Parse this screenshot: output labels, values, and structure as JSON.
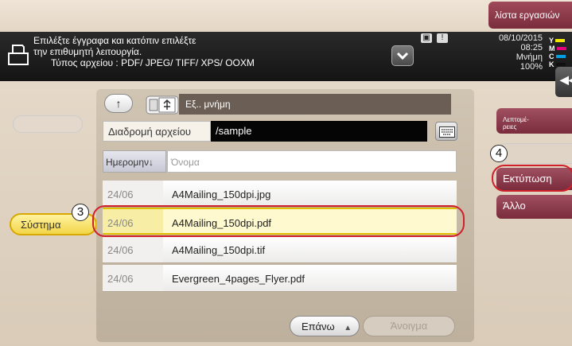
{
  "header": {
    "job_list": "λίστα εργασιών",
    "message_line1": "Επιλέξτε έγγραφα και κατόπιν επιλέξτε",
    "message_line2": "την επιθυμητή λειτουργία.",
    "message_line3": "Τύπος αρχείου      : PDF/ JPEG/ TIFF/ XPS/ OOXM",
    "date": "08/10/2015",
    "time": "08:25",
    "memory_label": "Μνήμη",
    "memory_value": "100%",
    "toner_labels": [
      "Y",
      "M",
      "C",
      "K"
    ],
    "toner_colors": [
      "#f3e600",
      "#e6007e",
      "#009fe3",
      "#111111"
    ],
    "collapse_icon": "double-chevron-left-icon",
    "collapse_glyph": "◀◀"
  },
  "left": {
    "system_label": "Σύστημα"
  },
  "panel": {
    "up_glyph": "↑",
    "location_label": "Εξ.. μνήμη",
    "path_label": "Διαδρομή αρχείου",
    "path_value": "/sample",
    "keyboard_icon": "keyboard-icon",
    "col_date": "Ημερομην",
    "sort_glyph": "↓",
    "col_name": "Όνομα",
    "rows": [
      {
        "date": "24/06",
        "name": "A4Mailing_150dpi.jpg"
      },
      {
        "date": "24/06",
        "name": "A4Mailing_150dpi.pdf"
      },
      {
        "date": "24/06",
        "name": "A4Mailing_150dpi.tif"
      },
      {
        "date": "24/06",
        "name": "Evergreen_4pages_Flyer.pdf"
      }
    ],
    "up_nav_label": "Επάνω",
    "up_nav_glyph": "▲",
    "open_label": "Άνοιγμα"
  },
  "right": {
    "details_line1": "Λεπτομέ-",
    "details_line2": "ρειες",
    "print_label": "Εκτύπωση",
    "other_label": "Άλλο"
  },
  "annotations": {
    "step3": "3",
    "step4": "4"
  }
}
